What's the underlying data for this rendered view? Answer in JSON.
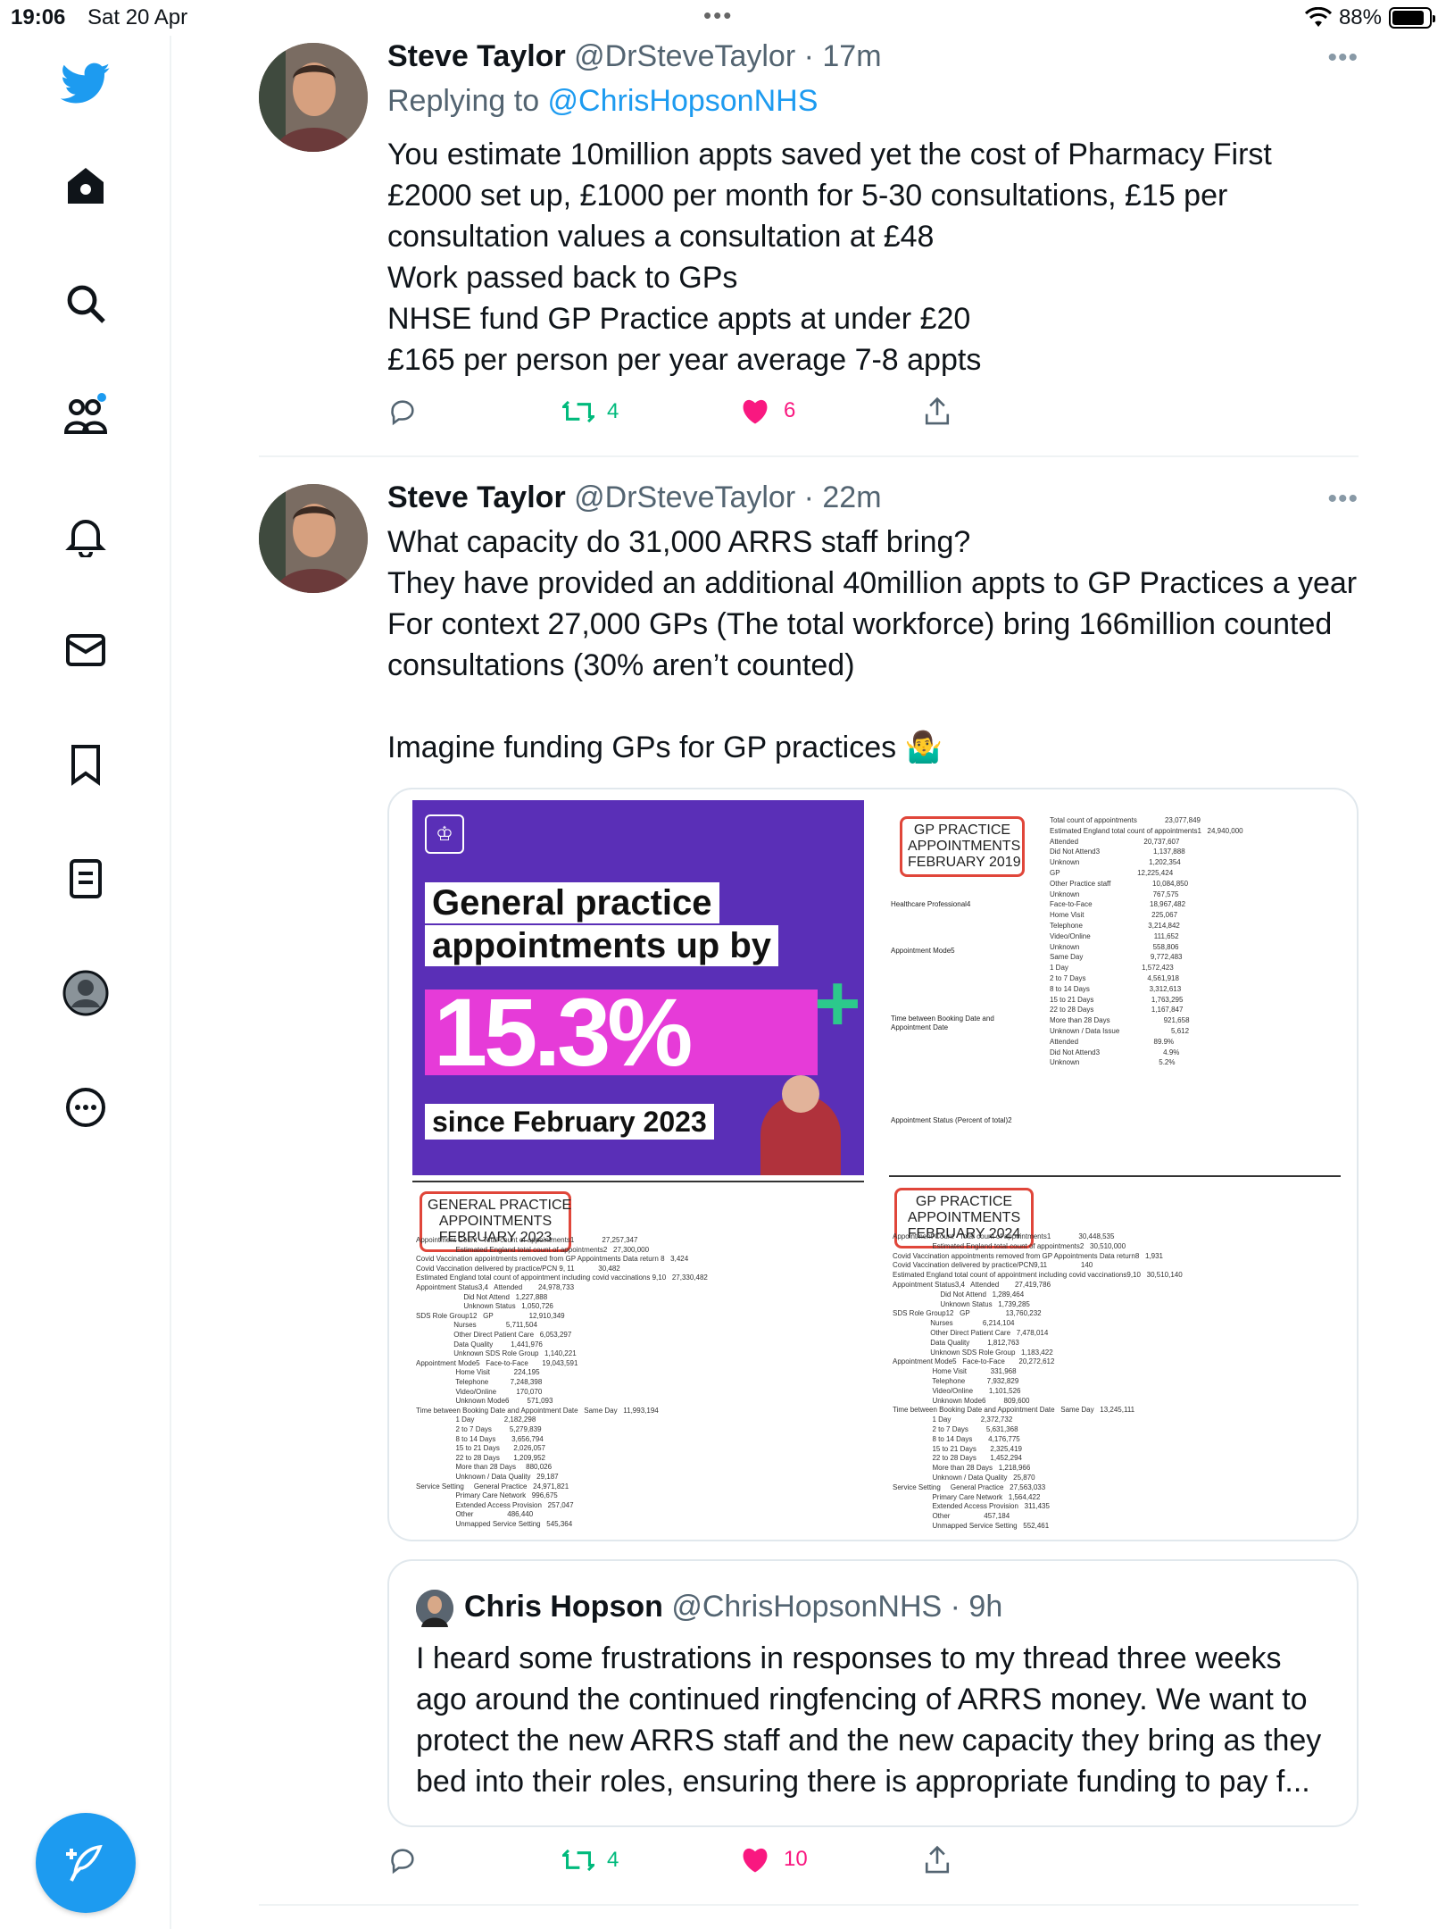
{
  "status": {
    "time": "19:06",
    "date": "Sat 20 Apr",
    "dots": "•••",
    "battery": "88%",
    "battery_level": 0.88
  },
  "sidebar": {
    "items": [
      "twitter-logo",
      "home",
      "explore",
      "communities",
      "notifications",
      "messages",
      "bookmarks",
      "lists",
      "profile",
      "more"
    ],
    "compose": "compose"
  },
  "tweets": [
    {
      "name": "Steve Taylor",
      "meta": "@DrSteveTaylor · 17m",
      "more": "•••",
      "replying_prefix": "Replying to ",
      "replying_mention": "@ChrisHopsonNHS",
      "lines": [
        "You estimate 10million appts saved yet the cost of Pharmacy First",
        "£2000 set up, £1000 per month for 5-30 consultations, £15 per",
        "consultation values a consultation at £48",
        "Work passed back to GPs",
        "NHSE fund GP Practice appts at under £20",
        "£165 per person per year average 7-8 appts"
      ],
      "retweets": "4",
      "likes": "6"
    },
    {
      "name": "Steve Taylor",
      "meta": "@DrSteveTaylor · 22m",
      "more": "•••",
      "lines": [
        "What capacity do 31,000 ARRS staff bring?",
        "They have provided an additional 40million appts to GP Practices a year",
        "For context 27,000 GPs (The total workforce) bring 166million counted",
        "consultations (30% aren’t counted)",
        "",
        "Imagine funding GPs for GP practices 🤷‍♂️"
      ],
      "media": {
        "promo_line1": "General practice",
        "promo_line2": "appointments up by",
        "promo_pct": "15.3%",
        "promo_plus": "+",
        "promo_since": "since February 2023",
        "stamp_2019": "GP PRACTICE\nAPPOINTMENTS\nFEBRUARY 2019",
        "stamp_2023": "GENERAL PRACTICE\nAPPOINTMENTS\nFEBRUARY 2023",
        "stamp_2024": "GP PRACTICE\nAPPOINTMENTS\nFEBRUARY 2024",
        "doc2019_rows": [
          "Total count of appointments              23,077,849",
          "Estimated England total count of appointments1   24,940,000",
          "Attended                                 20,737,607",
          "Did Not Attend3                           1,137,888",
          "Unknown                                   1,202,354",
          "GP                                       12,225,424",
          "Other Practice staff                     10,084,850",
          "Unknown                                     767,575",
          "Face-to-Face                             18,967,482",
          "Home Visit                                  225,067",
          "Telephone                                 3,214,842",
          "Video/Online                                111,652",
          "Unknown                                     558,806",
          "Same Day                                  9,772,483",
          "1 Day                                     1,572,423",
          "2 to 7 Days                               4,561,918",
          "8 to 14 Days                              3,312,613",
          "15 to 21 Days                             1,763,295",
          "22 to 28 Days                             1,167,847",
          "More than 28 Days                           921,658",
          "Unknown / Data Issue                          5,612",
          "Attended                                      89.9%",
          "Did Not Attend3                                4.9%",
          "Unknown                                        5.2%"
        ],
        "doc2019_labels": [
          "Healthcare Professional4",
          "Appointment Mode5",
          "Time between Booking Date and\nAppointment Date",
          "Appointment Status (Percent of total)2"
        ],
        "doc2023_rows": [
          "Appointment Count   Total count of appointments1              27,257,347",
          "                    Estimated England total count of appointments2   27,300,000",
          "Covid Vaccination appointments removed from GP Appointments Data return 8   3,424",
          "Covid Vaccination delivered by practice/PCN 9, 11            30,482",
          "Estimated England total count of appointment including covid vaccinations 9,10   27,330,482",
          "Appointment Status3,4   Attended        24,978,733",
          "                        Did Not Attend   1,227,888",
          "                        Unknown Status   1,050,726",
          "SDS Role Group12   GP                  12,910,349",
          "                   Nurses               5,711,504",
          "                   Other Direct Patient Care   6,053,297",
          "                   Data Quality         1,441,976",
          "                   Unknown SDS Role Group   1,140,221",
          "Appointment Mode5   Face-to-Face       19,043,591",
          "                    Home Visit            224,195",
          "                    Telephone           7,248,398",
          "                    Video/Online          170,070",
          "                    Unknown Mode6         571,093",
          "Time between Booking Date and Appointment Date   Same Day   11,993,194",
          "                    1 Day               2,182,298",
          "                    2 to 7 Days         5,279,839",
          "                    8 to 14 Days        3,656,794",
          "                    15 to 21 Days       2,026,057",
          "                    22 to 28 Days       1,209,952",
          "                    More than 28 Days     880,026",
          "                    Unknown / Data Quality   29,187",
          "Service Setting     General Practice   24,971,821",
          "                    Primary Care Network   996,675",
          "                    Extended Access Provision   257,047",
          "                    Other                 486,440",
          "                    Unmapped Service Setting   545,364"
        ],
        "doc2024_rows": [
          "Appointment Count   Total count of appointments1              30,448,535",
          "                    Estimated England total count of appointments2   30,510,000",
          "Covid Vaccination appointments removed from GP Appointments Data return8   1,931",
          "Covid Vaccination delivered by practice/PCN9,11                 140",
          "Estimated England total count of appointment including covid vaccinations9,10   30,510,140",
          "Appointment Status3,4   Attended        27,419,786",
          "                        Did Not Attend   1,289,464",
          "                        Unknown Status   1,739,285",
          "SDS Role Group12   GP                  13,760,232",
          "                   Nurses               6,214,104",
          "                   Other Direct Patient Care   7,478,014",
          "                   Data Quality         1,812,763",
          "                   Unknown SDS Role Group   1,183,422",
          "Appointment Mode5   Face-to-Face       20,272,612",
          "                    Home Visit            331,968",
          "                    Telephone           7,932,829",
          "                    Video/Online        1,101,526",
          "                    Unknown Mode6         809,600",
          "Time between Booking Date and Appointment Date   Same Day   13,245,111",
          "                    1 Day               2,372,732",
          "                    2 to 7 Days         5,631,368",
          "                    8 to 14 Days        4,176,775",
          "                    15 to 21 Days       2,325,419",
          "                    22 to 28 Days       1,452,294",
          "                    More than 28 Days   1,218,966",
          "                    Unknown / Data Quality   25,870",
          "Service Setting     General Practice   27,563,033",
          "                    Primary Care Network   1,564,422",
          "                    Extended Access Provision   311,435",
          "                    Other                 457,184",
          "                    Unmapped Service Setting   552,461"
        ]
      },
      "quote": {
        "name": "Chris Hopson",
        "meta": "@ChrisHopsonNHS · 9h",
        "lines": [
          "I heard some frustrations in responses to my thread three weeks",
          "ago around the continued ringfencing of ARRS money. We want to",
          "protect the new ARRS staff and the new capacity they bring as they",
          "bed into their roles, ensuring there is appropriate funding to pay f..."
        ]
      },
      "retweets": "4",
      "likes": "10"
    }
  ],
  "colors": {
    "accent": "#1d9bf0",
    "retweet": "#00ba7c",
    "like": "#f91880",
    "purple": "#5a2fb7",
    "magenta": "#e63bd8",
    "stamp": "#e0463a"
  }
}
